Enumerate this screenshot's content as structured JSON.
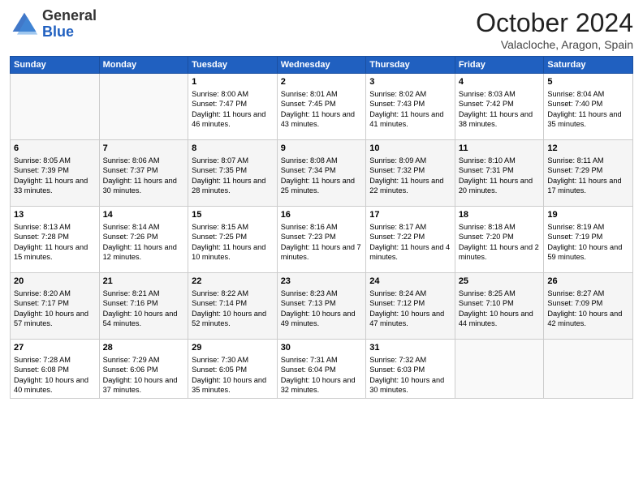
{
  "header": {
    "logo_general": "General",
    "logo_blue": "Blue",
    "title": "October 2024",
    "location": "Valacloche, Aragon, Spain"
  },
  "weekdays": [
    "Sunday",
    "Monday",
    "Tuesday",
    "Wednesday",
    "Thursday",
    "Friday",
    "Saturday"
  ],
  "weeks": [
    [
      {
        "day": "",
        "sunrise": "",
        "sunset": "",
        "daylight": ""
      },
      {
        "day": "",
        "sunrise": "",
        "sunset": "",
        "daylight": ""
      },
      {
        "day": "1",
        "sunrise": "Sunrise: 8:00 AM",
        "sunset": "Sunset: 7:47 PM",
        "daylight": "Daylight: 11 hours and 46 minutes."
      },
      {
        "day": "2",
        "sunrise": "Sunrise: 8:01 AM",
        "sunset": "Sunset: 7:45 PM",
        "daylight": "Daylight: 11 hours and 43 minutes."
      },
      {
        "day": "3",
        "sunrise": "Sunrise: 8:02 AM",
        "sunset": "Sunset: 7:43 PM",
        "daylight": "Daylight: 11 hours and 41 minutes."
      },
      {
        "day": "4",
        "sunrise": "Sunrise: 8:03 AM",
        "sunset": "Sunset: 7:42 PM",
        "daylight": "Daylight: 11 hours and 38 minutes."
      },
      {
        "day": "5",
        "sunrise": "Sunrise: 8:04 AM",
        "sunset": "Sunset: 7:40 PM",
        "daylight": "Daylight: 11 hours and 35 minutes."
      }
    ],
    [
      {
        "day": "6",
        "sunrise": "Sunrise: 8:05 AM",
        "sunset": "Sunset: 7:39 PM",
        "daylight": "Daylight: 11 hours and 33 minutes."
      },
      {
        "day": "7",
        "sunrise": "Sunrise: 8:06 AM",
        "sunset": "Sunset: 7:37 PM",
        "daylight": "Daylight: 11 hours and 30 minutes."
      },
      {
        "day": "8",
        "sunrise": "Sunrise: 8:07 AM",
        "sunset": "Sunset: 7:35 PM",
        "daylight": "Daylight: 11 hours and 28 minutes."
      },
      {
        "day": "9",
        "sunrise": "Sunrise: 8:08 AM",
        "sunset": "Sunset: 7:34 PM",
        "daylight": "Daylight: 11 hours and 25 minutes."
      },
      {
        "day": "10",
        "sunrise": "Sunrise: 8:09 AM",
        "sunset": "Sunset: 7:32 PM",
        "daylight": "Daylight: 11 hours and 22 minutes."
      },
      {
        "day": "11",
        "sunrise": "Sunrise: 8:10 AM",
        "sunset": "Sunset: 7:31 PM",
        "daylight": "Daylight: 11 hours and 20 minutes."
      },
      {
        "day": "12",
        "sunrise": "Sunrise: 8:11 AM",
        "sunset": "Sunset: 7:29 PM",
        "daylight": "Daylight: 11 hours and 17 minutes."
      }
    ],
    [
      {
        "day": "13",
        "sunrise": "Sunrise: 8:13 AM",
        "sunset": "Sunset: 7:28 PM",
        "daylight": "Daylight: 11 hours and 15 minutes."
      },
      {
        "day": "14",
        "sunrise": "Sunrise: 8:14 AM",
        "sunset": "Sunset: 7:26 PM",
        "daylight": "Daylight: 11 hours and 12 minutes."
      },
      {
        "day": "15",
        "sunrise": "Sunrise: 8:15 AM",
        "sunset": "Sunset: 7:25 PM",
        "daylight": "Daylight: 11 hours and 10 minutes."
      },
      {
        "day": "16",
        "sunrise": "Sunrise: 8:16 AM",
        "sunset": "Sunset: 7:23 PM",
        "daylight": "Daylight: 11 hours and 7 minutes."
      },
      {
        "day": "17",
        "sunrise": "Sunrise: 8:17 AM",
        "sunset": "Sunset: 7:22 PM",
        "daylight": "Daylight: 11 hours and 4 minutes."
      },
      {
        "day": "18",
        "sunrise": "Sunrise: 8:18 AM",
        "sunset": "Sunset: 7:20 PM",
        "daylight": "Daylight: 11 hours and 2 minutes."
      },
      {
        "day": "19",
        "sunrise": "Sunrise: 8:19 AM",
        "sunset": "Sunset: 7:19 PM",
        "daylight": "Daylight: 10 hours and 59 minutes."
      }
    ],
    [
      {
        "day": "20",
        "sunrise": "Sunrise: 8:20 AM",
        "sunset": "Sunset: 7:17 PM",
        "daylight": "Daylight: 10 hours and 57 minutes."
      },
      {
        "day": "21",
        "sunrise": "Sunrise: 8:21 AM",
        "sunset": "Sunset: 7:16 PM",
        "daylight": "Daylight: 10 hours and 54 minutes."
      },
      {
        "day": "22",
        "sunrise": "Sunrise: 8:22 AM",
        "sunset": "Sunset: 7:14 PM",
        "daylight": "Daylight: 10 hours and 52 minutes."
      },
      {
        "day": "23",
        "sunrise": "Sunrise: 8:23 AM",
        "sunset": "Sunset: 7:13 PM",
        "daylight": "Daylight: 10 hours and 49 minutes."
      },
      {
        "day": "24",
        "sunrise": "Sunrise: 8:24 AM",
        "sunset": "Sunset: 7:12 PM",
        "daylight": "Daylight: 10 hours and 47 minutes."
      },
      {
        "day": "25",
        "sunrise": "Sunrise: 8:25 AM",
        "sunset": "Sunset: 7:10 PM",
        "daylight": "Daylight: 10 hours and 44 minutes."
      },
      {
        "day": "26",
        "sunrise": "Sunrise: 8:27 AM",
        "sunset": "Sunset: 7:09 PM",
        "daylight": "Daylight: 10 hours and 42 minutes."
      }
    ],
    [
      {
        "day": "27",
        "sunrise": "Sunrise: 7:28 AM",
        "sunset": "Sunset: 6:08 PM",
        "daylight": "Daylight: 10 hours and 40 minutes."
      },
      {
        "day": "28",
        "sunrise": "Sunrise: 7:29 AM",
        "sunset": "Sunset: 6:06 PM",
        "daylight": "Daylight: 10 hours and 37 minutes."
      },
      {
        "day": "29",
        "sunrise": "Sunrise: 7:30 AM",
        "sunset": "Sunset: 6:05 PM",
        "daylight": "Daylight: 10 hours and 35 minutes."
      },
      {
        "day": "30",
        "sunrise": "Sunrise: 7:31 AM",
        "sunset": "Sunset: 6:04 PM",
        "daylight": "Daylight: 10 hours and 32 minutes."
      },
      {
        "day": "31",
        "sunrise": "Sunrise: 7:32 AM",
        "sunset": "Sunset: 6:03 PM",
        "daylight": "Daylight: 10 hours and 30 minutes."
      },
      {
        "day": "",
        "sunrise": "",
        "sunset": "",
        "daylight": ""
      },
      {
        "day": "",
        "sunrise": "",
        "sunset": "",
        "daylight": ""
      }
    ]
  ]
}
